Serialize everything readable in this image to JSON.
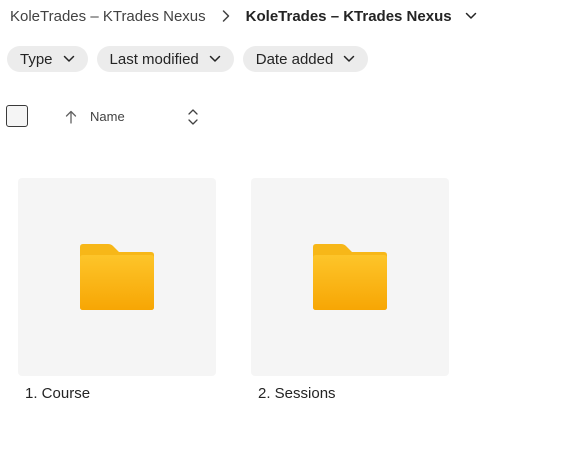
{
  "breadcrumb": {
    "parent": "KoleTrades – KTrades Nexus",
    "current": "KoleTrades – KTrades Nexus"
  },
  "filters": [
    {
      "label": "Type"
    },
    {
      "label": "Last modified"
    },
    {
      "label": "Date added"
    }
  ],
  "list_header": {
    "name_column": "Name"
  },
  "items": [
    {
      "name": "1. Course",
      "type": "folder"
    },
    {
      "name": "2. Sessions",
      "type": "folder"
    }
  ],
  "colors": {
    "folder_top": "#FDC52A",
    "folder_bottom": "#F7A604",
    "tile_bg": "#F5F5F5",
    "pill_bg": "#ECECEC"
  },
  "icons": {
    "separator": "chevron-right-icon",
    "dropdown": "chevron-down-icon",
    "sort": "arrow-up-icon",
    "sort_toggle": "sort-up-down-icon",
    "item": "folder-icon"
  }
}
